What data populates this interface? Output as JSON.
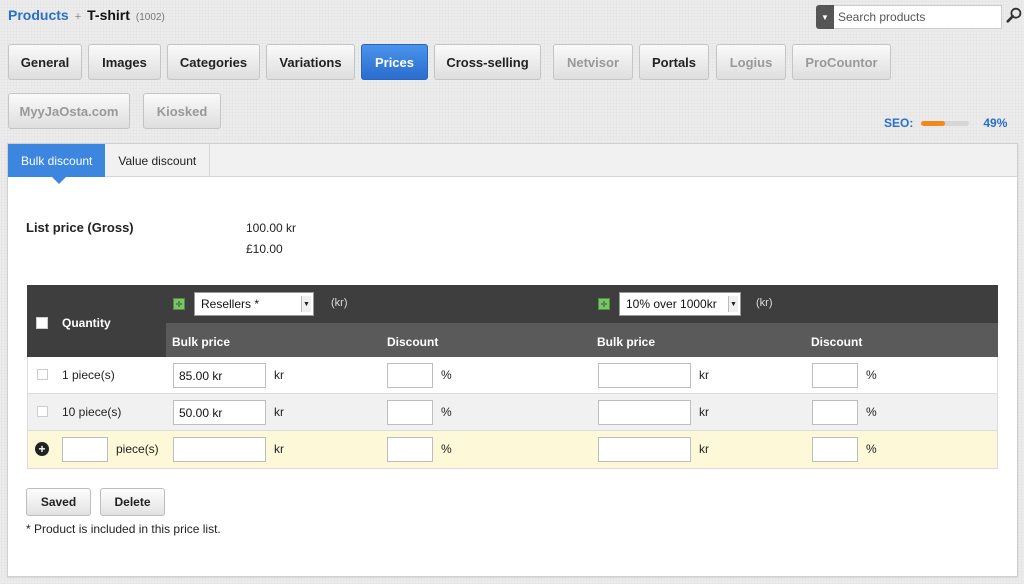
{
  "breadcrumb": {
    "root": "Products",
    "separator": "+",
    "title": "T-shirt",
    "id": "(1002)"
  },
  "search": {
    "placeholder": "Search products"
  },
  "tabs": [
    {
      "label": "General",
      "state": "normal"
    },
    {
      "label": "Images",
      "state": "normal"
    },
    {
      "label": "Categories",
      "state": "normal"
    },
    {
      "label": "Variations",
      "state": "normal"
    },
    {
      "label": "Prices",
      "state": "active"
    },
    {
      "label": "Cross-selling",
      "state": "normal"
    },
    {
      "label": "Netvisor",
      "state": "disabled"
    },
    {
      "label": "Portals",
      "state": "normal"
    },
    {
      "label": "Logius",
      "state": "disabled"
    },
    {
      "label": "ProCountor",
      "state": "disabled"
    },
    {
      "label": "MyyJaOsta.com",
      "state": "disabled"
    },
    {
      "label": "Kiosked",
      "state": "disabled"
    }
  ],
  "seo": {
    "label": "SEO:",
    "value": "49%",
    "fraction": 0.49
  },
  "subtabs": {
    "bulk": "Bulk discount",
    "value": "Value discount"
  },
  "list_price": {
    "label": "List price (Gross)",
    "value_kr": "100.00 kr",
    "value_gbp": "£10.00"
  },
  "table": {
    "quantity_header": "Quantity",
    "list1": {
      "selected": "Resellers *",
      "currency": "(kr)"
    },
    "list2": {
      "selected": "10% over 1000kr",
      "currency": "(kr)"
    },
    "bulk_price_header": "Bulk price",
    "discount_header": "Discount",
    "rows": [
      {
        "quantity": "1 piece(s)",
        "price1": "85.00 kr",
        "discount1": "",
        "price2": "",
        "discount2": ""
      },
      {
        "quantity": "10 piece(s)",
        "price1": "50.00 kr",
        "discount1": "",
        "price2": "",
        "discount2": ""
      }
    ],
    "new_row": {
      "qty_value": "",
      "qty_unit": "piece(s)"
    },
    "price_unit": "kr",
    "discount_unit": "%"
  },
  "buttons": {
    "saved": "Saved",
    "delete": "Delete"
  },
  "footnote": "* Product is included in this price list.",
  "colors": {
    "accent": "#3d86e0",
    "seo_fill": "#f08a1a",
    "new_row": "#fcf8d8",
    "header_dark": "#3e3e3e"
  }
}
